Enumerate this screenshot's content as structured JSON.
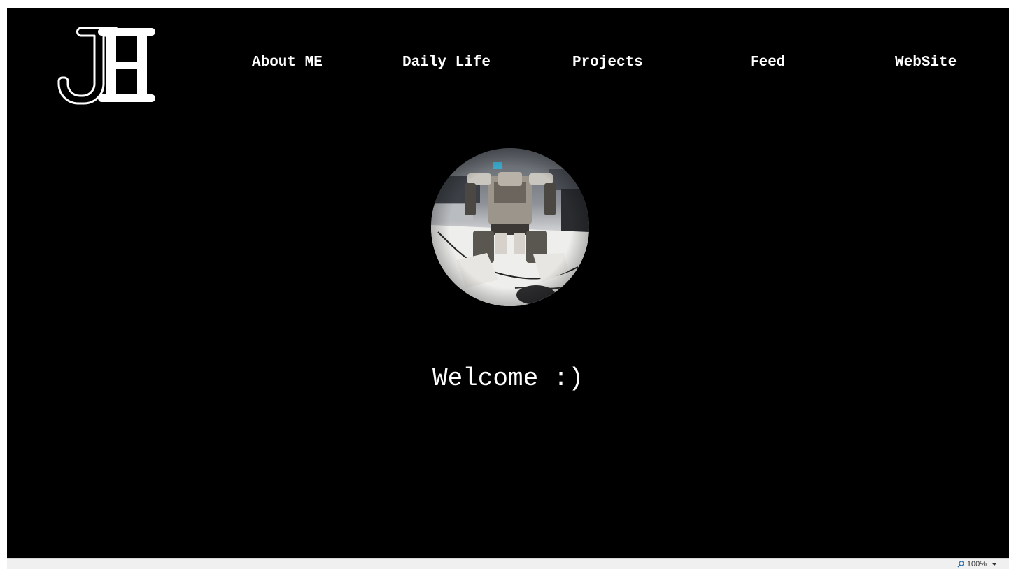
{
  "logo": {
    "letters": "JH",
    "color": "#ffffff"
  },
  "nav": {
    "items": [
      {
        "label": "About ME"
      },
      {
        "label": "Daily Life"
      },
      {
        "label": "Projects"
      },
      {
        "label": "Feed"
      },
      {
        "label": "WebSite"
      }
    ]
  },
  "hero": {
    "photo_subject": "humanoid-robot-photo",
    "welcome_text": "Welcome :)"
  },
  "statusbar": {
    "zoom_level": "100%"
  },
  "colors": {
    "background": "#000000",
    "text": "#ffffff",
    "statusbar": "#f0f0f0"
  }
}
